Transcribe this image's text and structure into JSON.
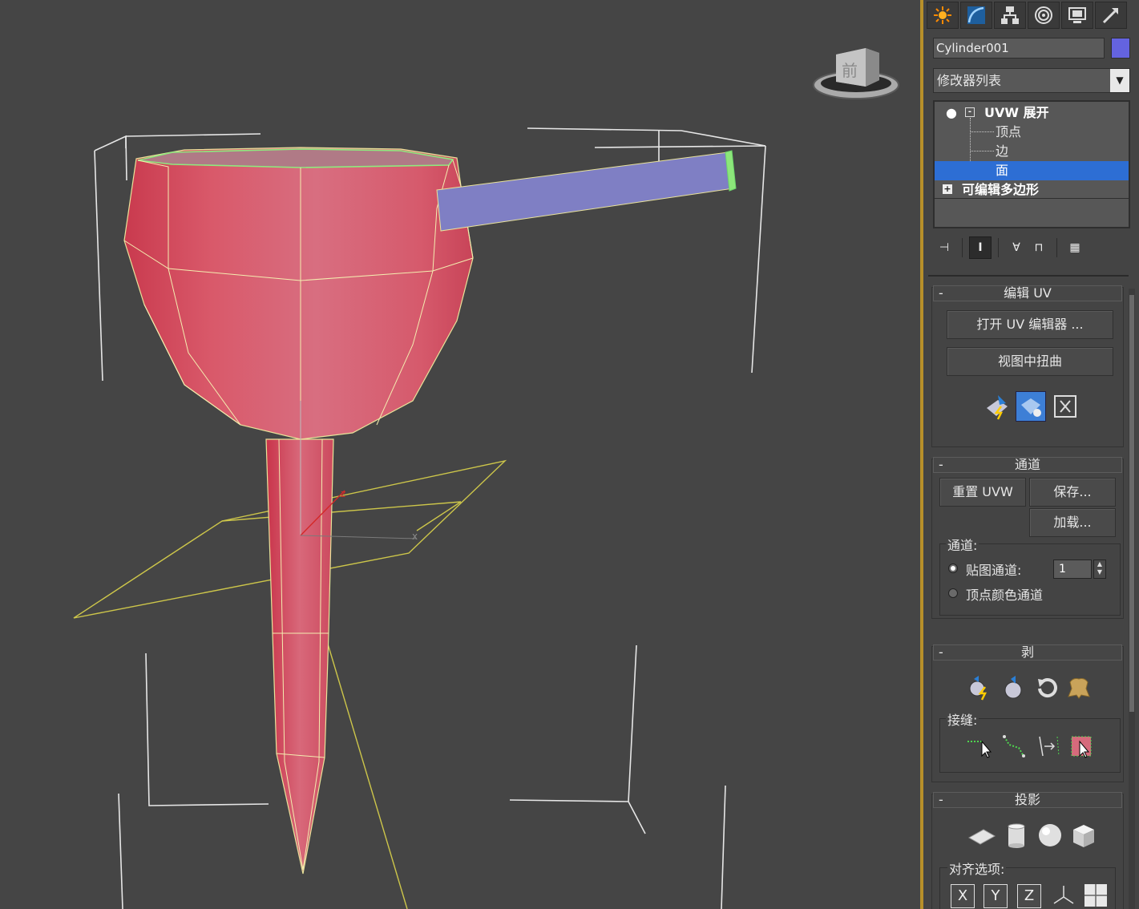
{
  "viewcube": {
    "face_label": "前"
  },
  "gizmo": {
    "z_label": "z",
    "x_label": "x"
  },
  "command_panel": {
    "tabs": [
      "create-icon",
      "modify-icon",
      "hierarchy-icon",
      "motion-icon",
      "display-icon",
      "utilities-icon"
    ],
    "object_name": "Cylinder001",
    "object_color": "#6463e0",
    "modifier_list": "修改器列表",
    "stack": {
      "uvw_unwrap": "UVW 展开",
      "sub_vertex": "顶点",
      "sub_edge": "边",
      "sub_face": "面",
      "editable_poly": "可编辑多边形"
    }
  },
  "edit_uv": {
    "title": "编辑 UV",
    "open_uv_editor": "打开 UV 编辑器 ...",
    "tweak_in_view": "视图中扭曲"
  },
  "channel": {
    "title": "通道",
    "reset_uvw": "重置 UVW",
    "save": "保存...",
    "load": "加载...",
    "group_label": "通道:",
    "map_channel": "贴图通道:",
    "map_channel_value": "1",
    "vertex_color_channel": "顶点颜色通道"
  },
  "peel": {
    "title": "剥",
    "seams_label": "接缝:"
  },
  "projection": {
    "title": "投影",
    "align_label": "对齐选项:",
    "x": "X",
    "y": "Y",
    "z": "Z"
  },
  "rollout_minus": "-"
}
